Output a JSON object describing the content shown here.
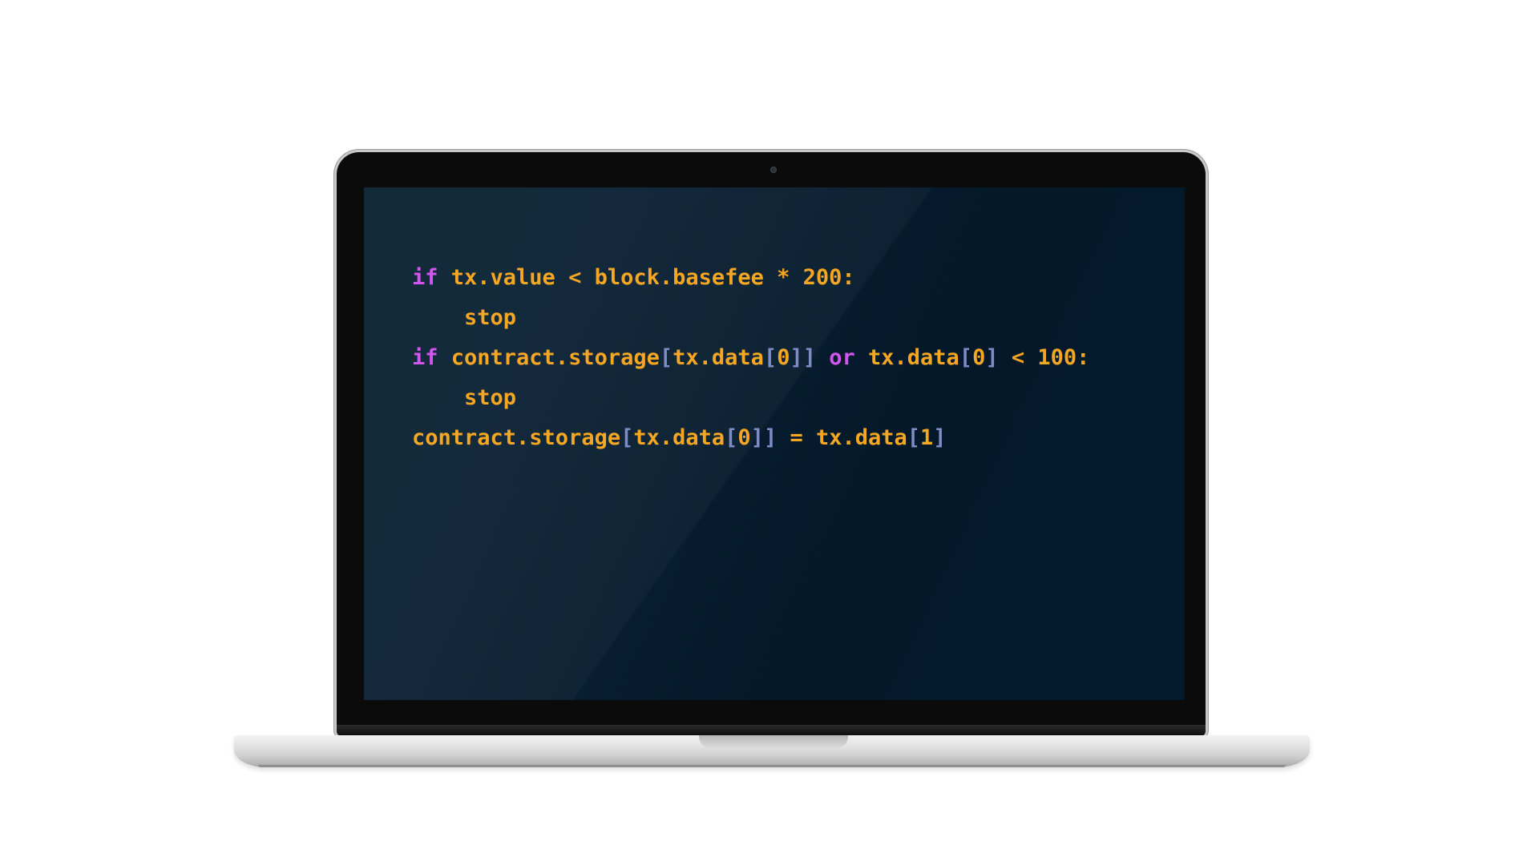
{
  "code_editor": {
    "lines": [
      [
        {
          "text": "if",
          "kind": "keyword"
        },
        {
          "text": " tx.value < block.basefee * 200:",
          "kind": "text"
        }
      ],
      [
        {
          "text": "    stop",
          "kind": "text"
        }
      ],
      [
        {
          "text": "if",
          "kind": "keyword"
        },
        {
          "text": " contract.storage",
          "kind": "text"
        },
        {
          "text": "[",
          "kind": "bracket"
        },
        {
          "text": "tx.data",
          "kind": "text"
        },
        {
          "text": "[",
          "kind": "bracket"
        },
        {
          "text": "0",
          "kind": "text"
        },
        {
          "text": "]]",
          "kind": "bracket"
        },
        {
          "text": " ",
          "kind": "text"
        },
        {
          "text": "or",
          "kind": "keyword"
        },
        {
          "text": " tx.data",
          "kind": "text"
        },
        {
          "text": "[",
          "kind": "bracket"
        },
        {
          "text": "0",
          "kind": "text"
        },
        {
          "text": "]",
          "kind": "bracket"
        },
        {
          "text": " < 100:",
          "kind": "text"
        }
      ],
      [
        {
          "text": "    stop",
          "kind": "text"
        }
      ],
      [
        {
          "text": "contract.storage",
          "kind": "text"
        },
        {
          "text": "[",
          "kind": "bracket"
        },
        {
          "text": "tx.data",
          "kind": "text"
        },
        {
          "text": "[",
          "kind": "bracket"
        },
        {
          "text": "0",
          "kind": "text"
        },
        {
          "text": "]]",
          "kind": "bracket"
        },
        {
          "text": " = tx.data",
          "kind": "text"
        },
        {
          "text": "[",
          "kind": "bracket"
        },
        {
          "text": "1",
          "kind": "text"
        },
        {
          "text": "]",
          "kind": "bracket"
        }
      ]
    ]
  },
  "colors": {
    "screen_background": "#03192a",
    "code_text": "#f5a623",
    "keyword": "#d454ef",
    "bracket": "#7d8cc4",
    "bezel": "#0b0b0b",
    "chassis": "#d9d9d9"
  },
  "icons": {
    "camera": "webcam-dot-icon"
  }
}
